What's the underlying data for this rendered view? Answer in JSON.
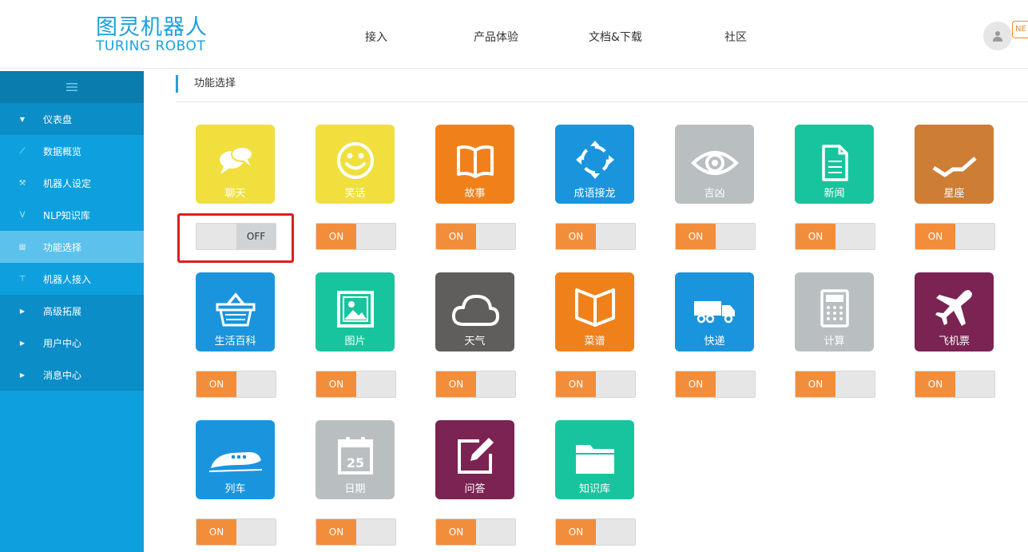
{
  "logo": {
    "cn": "图灵机器人",
    "en": "TURING ROBOT"
  },
  "nav": [
    "接入",
    "产品体验",
    "文档&下载",
    "社区"
  ],
  "badge": "NE",
  "sidebar": {
    "items": [
      {
        "label": "仪表盘",
        "icon": "caret-down-icon",
        "kind": "main"
      },
      {
        "label": "数据概览",
        "icon": "chart-icon",
        "kind": "sub"
      },
      {
        "label": "机器人设定",
        "icon": "wrench-icon",
        "kind": "sub"
      },
      {
        "label": "NLP知识库",
        "icon": "nlp-icon",
        "kind": "sub"
      },
      {
        "label": "功能选择",
        "icon": "grid-icon",
        "kind": "active"
      },
      {
        "label": "机器人接入",
        "icon": "plug-icon",
        "kind": "sub"
      },
      {
        "label": "高级拓展",
        "icon": "caret-right-icon",
        "kind": "group"
      },
      {
        "label": "用户中心",
        "icon": "caret-right-icon",
        "kind": "group"
      },
      {
        "label": "消息中心",
        "icon": "caret-right-icon",
        "kind": "group"
      }
    ]
  },
  "breadcrumb": "功能选择",
  "toggle_labels": {
    "on": "ON",
    "off": "OFF"
  },
  "features": [
    {
      "label": "聊天",
      "color": "#f0df3d",
      "icon": "chat-icon",
      "state": "off"
    },
    {
      "label": "笑话",
      "color": "#f0df3d",
      "icon": "smile-icon",
      "state": "on"
    },
    {
      "label": "故事",
      "color": "#f0811a",
      "icon": "book-open-icon",
      "state": "on"
    },
    {
      "label": "成语接龙",
      "color": "#1a95dd",
      "icon": "cycle-arrows-icon",
      "state": "on"
    },
    {
      "label": "吉凶",
      "color": "#b9bec1",
      "icon": "eye-icon",
      "state": "on"
    },
    {
      "label": "新闻",
      "color": "#18c49d",
      "icon": "document-icon",
      "state": "on"
    },
    {
      "label": "星座",
      "color": "#cd7d34",
      "icon": "trend-line-icon",
      "state": "on"
    },
    {
      "label": "生活百科",
      "color": "#1a95dd",
      "icon": "basket-icon",
      "state": "on"
    },
    {
      "label": "图片",
      "color": "#18c49d",
      "icon": "picture-icon",
      "state": "on"
    },
    {
      "label": "天气",
      "color": "#5f5e5d",
      "icon": "cloud-icon",
      "state": "on"
    },
    {
      "label": "菜谱",
      "color": "#f0811a",
      "icon": "open-book-icon",
      "state": "on"
    },
    {
      "label": "快递",
      "color": "#1a95dd",
      "icon": "truck-icon",
      "state": "on"
    },
    {
      "label": "计算",
      "color": "#b9bec1",
      "icon": "calculator-icon",
      "state": "on"
    },
    {
      "label": "飞机票",
      "color": "#7b2353",
      "icon": "airplane-icon",
      "state": "on"
    },
    {
      "label": "列车",
      "color": "#1a95dd",
      "icon": "train-icon",
      "state": "on"
    },
    {
      "label": "日期",
      "color": "#b9bec1",
      "icon": "calendar-icon",
      "state": "on",
      "icon_text": "25"
    },
    {
      "label": "问答",
      "color": "#7b2353",
      "icon": "edit-icon",
      "state": "on"
    },
    {
      "label": "知识库",
      "color": "#18c49d",
      "icon": "folder-icon",
      "state": "on"
    }
  ]
}
